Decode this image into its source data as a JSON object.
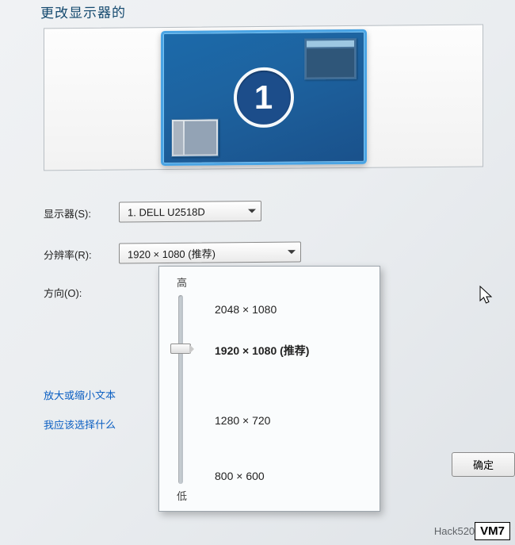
{
  "page_title": "更改显示器的",
  "monitor": {
    "number": "1"
  },
  "fields": {
    "display_label": "显示器(S):",
    "display_value": "1. DELL U2518D",
    "resolution_label": "分辨率(R):",
    "resolution_value": "1920 × 1080 (推荐)",
    "orientation_label": "方向(O):"
  },
  "links": {
    "text_size": "放大或缩小文本",
    "what_choose": "我应该选择什么"
  },
  "resolution_popup": {
    "label_high": "高",
    "label_low": "低",
    "options": [
      "2048 × 1080",
      "1920 × 1080 (推荐)",
      "1280 × 720",
      "800 × 600"
    ]
  },
  "buttons": {
    "ok": "确定"
  },
  "watermark": {
    "text": "Hack520",
    "box": "VM7"
  }
}
